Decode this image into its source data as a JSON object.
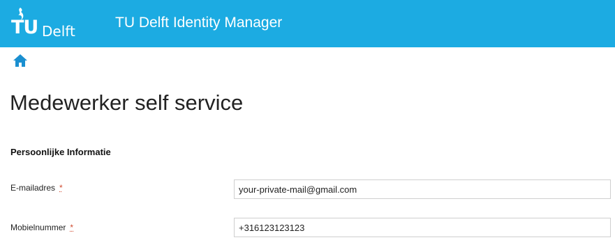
{
  "header": {
    "logo_mark": "TU",
    "logo_word": "Delft",
    "app_title": "TU Delft Identity Manager",
    "background_color": "#1cabe2"
  },
  "nav": {
    "home_icon": "home-icon"
  },
  "page": {
    "title": "Medewerker self service"
  },
  "section": {
    "title": "Persoonlijke Informatie"
  },
  "fields": {
    "email": {
      "label": "E-mailadres",
      "required_marker": "*",
      "value": "your-private-mail@gmail.com"
    },
    "mobile": {
      "label": "Mobielnummer",
      "required_marker": "*",
      "value": "+316123123123"
    }
  }
}
